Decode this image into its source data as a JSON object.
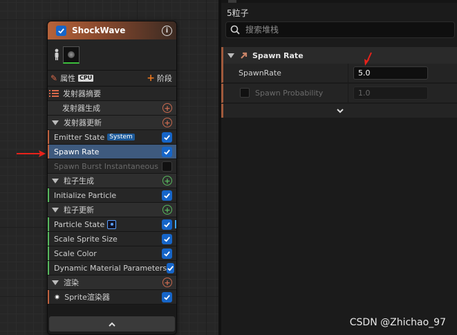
{
  "graph": {
    "node": {
      "title": "ShockWave",
      "properties_label": "属性",
      "sim_target": "CPU",
      "stage_label": "阶段",
      "rows": [
        {
          "kind": "module",
          "label": "发射器摘要",
          "icon": "list-icon",
          "accent": "",
          "checked": null
        },
        {
          "kind": "section-child",
          "label": "发射器生成",
          "add": "orange"
        },
        {
          "kind": "section",
          "label": "发射器更新",
          "add": "orange"
        },
        {
          "kind": "item",
          "label": "Emitter State",
          "badge": "System",
          "accent": "#c0623f",
          "checked": true
        },
        {
          "kind": "item",
          "label": "Spawn Rate",
          "accent": "#c0623f",
          "checked": true,
          "selected": true
        },
        {
          "kind": "item",
          "label": "Spawn Burst Instantaneous",
          "accent": "",
          "checked": false,
          "disabled": true
        },
        {
          "kind": "section",
          "label": "粒子生成",
          "add": "green"
        },
        {
          "kind": "item",
          "label": "Initialize Particle",
          "accent": "#58b95e",
          "checked": true
        },
        {
          "kind": "section",
          "label": "粒子更新",
          "add": "green"
        },
        {
          "kind": "item",
          "label": "Particle State",
          "accent": "#58b95e",
          "checked": true,
          "state_badge": true,
          "blue_tick": true
        },
        {
          "kind": "item",
          "label": "Scale Sprite Size",
          "accent": "#58b95e",
          "checked": true
        },
        {
          "kind": "item",
          "label": "Scale Color",
          "accent": "#58b95e",
          "checked": true
        },
        {
          "kind": "item",
          "label": "Dynamic Material Parameters",
          "accent": "#58b95e",
          "checked": true
        },
        {
          "kind": "section",
          "label": "渲染",
          "add": "orange"
        },
        {
          "kind": "item",
          "label": "Sprite渲染器",
          "accent": "#c0623f",
          "checked": true,
          "renderer": true
        }
      ]
    }
  },
  "details": {
    "title": "5粒子",
    "search_placeholder": "搜索堆栈",
    "category": "Spawn Rate",
    "props": [
      {
        "label": "SpawnRate",
        "value": "5.0"
      },
      {
        "label": "Spawn Probability",
        "value": "1.0",
        "disabled": true
      }
    ]
  },
  "watermark": "CSDN @Zhichao_97",
  "colors": {
    "accent_orange": "#c0623f",
    "accent_green": "#58b95e",
    "selected": "#3e5a7e",
    "check_blue": "#1665c8",
    "annotation_red": "#e8221b"
  }
}
